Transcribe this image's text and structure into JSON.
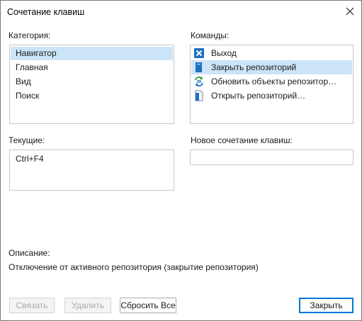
{
  "window": {
    "title": "Сочетание клавиш",
    "close_icon": "close-icon"
  },
  "category": {
    "label": "Категория:",
    "items": [
      "Навигатор",
      "Главная",
      "Вид",
      "Поиск"
    ],
    "selected_index": 0
  },
  "commands": {
    "label": "Команды:",
    "items": [
      {
        "label": "Выход",
        "icon": "exit-icon"
      },
      {
        "label": "Закрыть репозиторий",
        "icon": "close-repository-icon"
      },
      {
        "label": "Обновить объекты репозитор…",
        "icon": "refresh-objects-icon"
      },
      {
        "label": "Открыть репозиторий…",
        "icon": "open-repository-icon"
      }
    ],
    "selected_index": 1
  },
  "current": {
    "label": "Текущие:",
    "items": [
      "Ctrl+F4"
    ]
  },
  "new_shortcut": {
    "label": "Новое сочетание клавиш:",
    "value": ""
  },
  "description": {
    "label": "Описание:",
    "text": "Отключение от активного репозитория (закрытие репозитория)"
  },
  "buttons": {
    "assign": "Связать",
    "delete": "Удалить",
    "reset_all": "Сбросить Все",
    "close": "Закрыть"
  },
  "colors": {
    "selection": "#cce4f7",
    "accent": "#0078d7"
  }
}
